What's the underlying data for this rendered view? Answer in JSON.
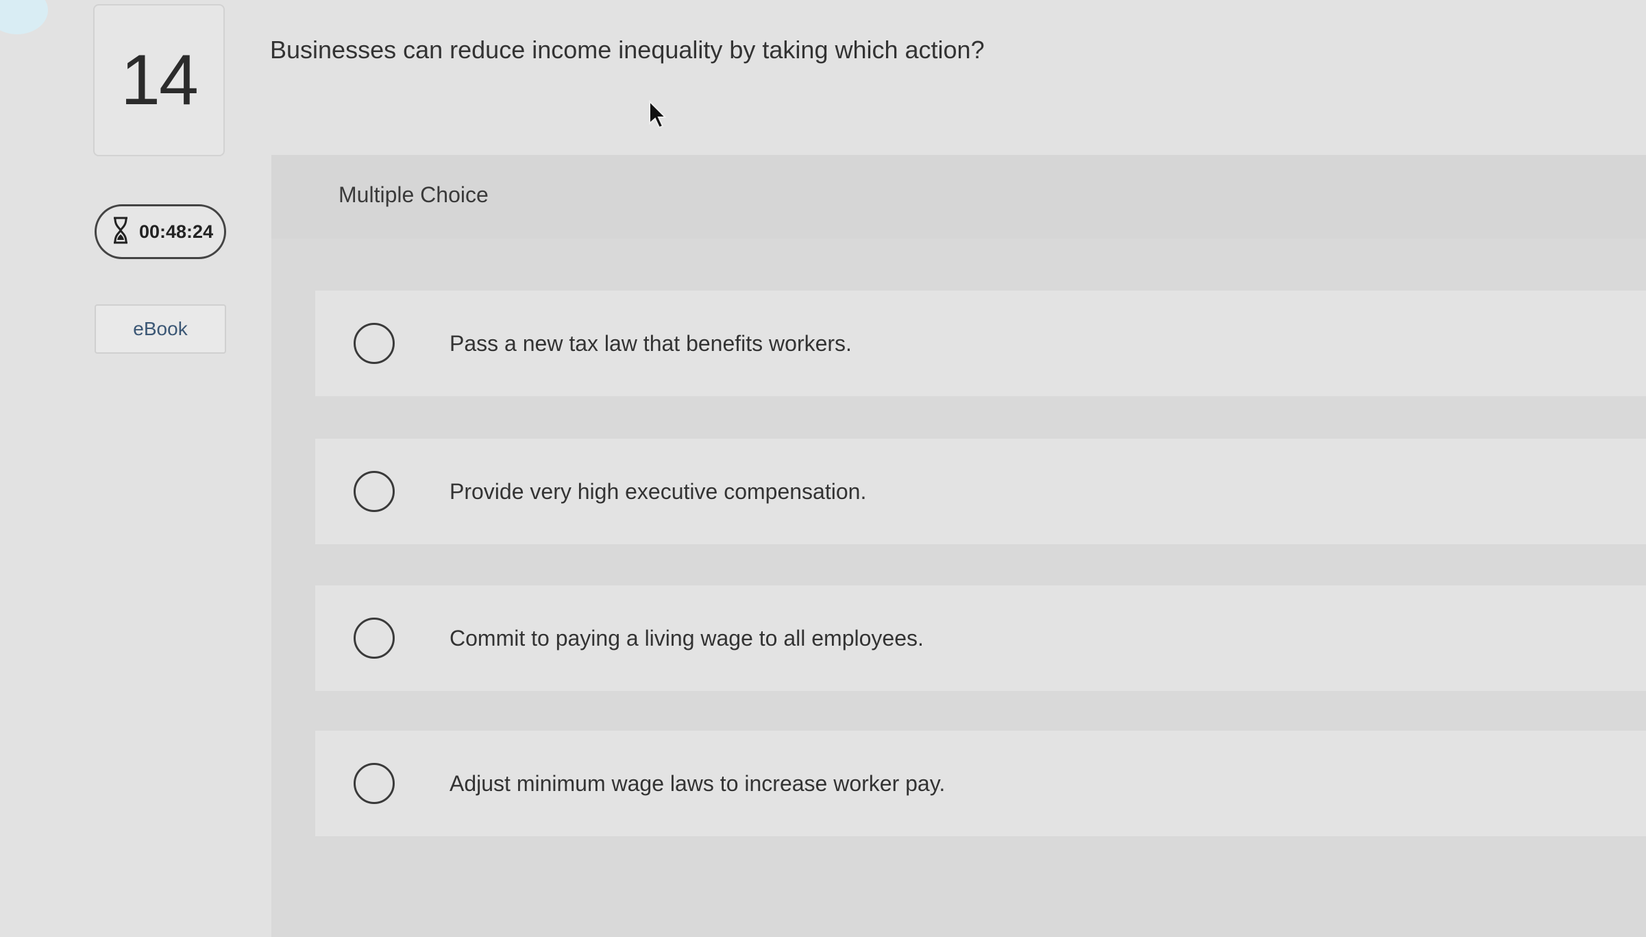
{
  "question": {
    "number": "14",
    "text": "Businesses can reduce income inequality by taking which action?",
    "type_label": "Multiple Choice"
  },
  "timer": {
    "icon": "hourglass-icon",
    "value": "00:48:24"
  },
  "ebook": {
    "label": "eBook"
  },
  "choices": [
    {
      "label": "Pass a new tax law that benefits workers.",
      "selected": false
    },
    {
      "label": "Provide very high executive compensation.",
      "selected": false
    },
    {
      "label": "Commit to paying a living wage to all employees.",
      "selected": false
    },
    {
      "label": "Adjust minimum wage laws to increase worker pay.",
      "selected": false
    }
  ],
  "colors": {
    "background": "#e2e2e2",
    "panel": "#d9d9d9",
    "choice_row": "#e3e3e3",
    "link": "#3b5775"
  }
}
